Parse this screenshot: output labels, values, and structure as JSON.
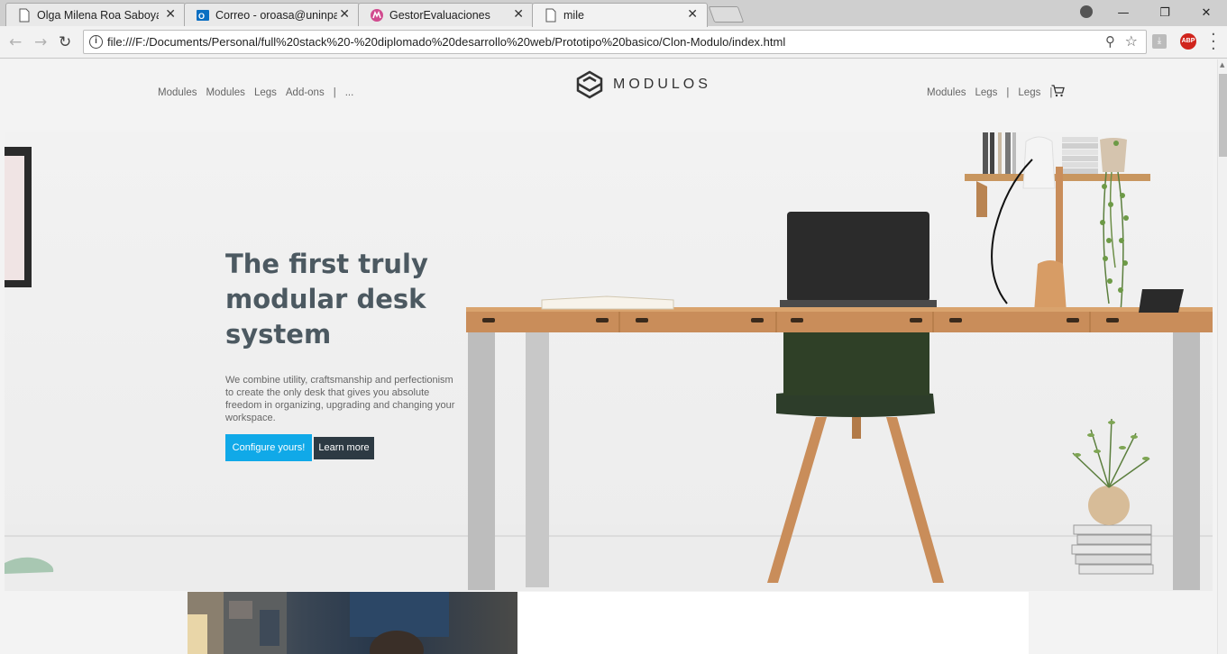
{
  "browser": {
    "tabs": [
      {
        "title": "Olga Milena Roa Saboya",
        "icon": "page-icon",
        "active": false
      },
      {
        "title": "Correo - oroasa@uninpa",
        "icon": "outlook-icon",
        "active": false
      },
      {
        "title": "GestorEvaluaciones",
        "icon": "gestor-icon",
        "active": false
      },
      {
        "title": "mile",
        "icon": "page-icon",
        "active": true
      }
    ],
    "close_glyph": "✕",
    "url": "file:///F:/Documents/Personal/full%20stack%20-%20diplomado%20desarrollo%20web/Prototipo%20basico/Clon-Modulo/index.html",
    "info_glyph": "i",
    "window_controls": [
      "—",
      "❐",
      "✕"
    ],
    "ext_abp": "ABP",
    "ext_pdf": "⤓"
  },
  "site": {
    "logo_text": "MODULOS",
    "nav_left": [
      "Modules",
      "Modules",
      "Legs",
      "Add-ons",
      "|",
      "..."
    ],
    "nav_right": [
      "Modules",
      "Legs",
      "|",
      "Legs",
      "|"
    ],
    "hero": {
      "title": "The first truly modular desk system",
      "text": "We combine utility, craftsmanship and perfectionism to create the only desk that gives you absolute freedom in organizing, upgrading and changing your workspace.",
      "btn_configure": "Configure yours!",
      "btn_learn": "Learn more"
    },
    "colors": {
      "accent": "#10a9e8",
      "dark_button": "#2d3a43",
      "title": "#4c5961",
      "chair": "#2d3d2a",
      "wood": "#c98d5a"
    }
  }
}
